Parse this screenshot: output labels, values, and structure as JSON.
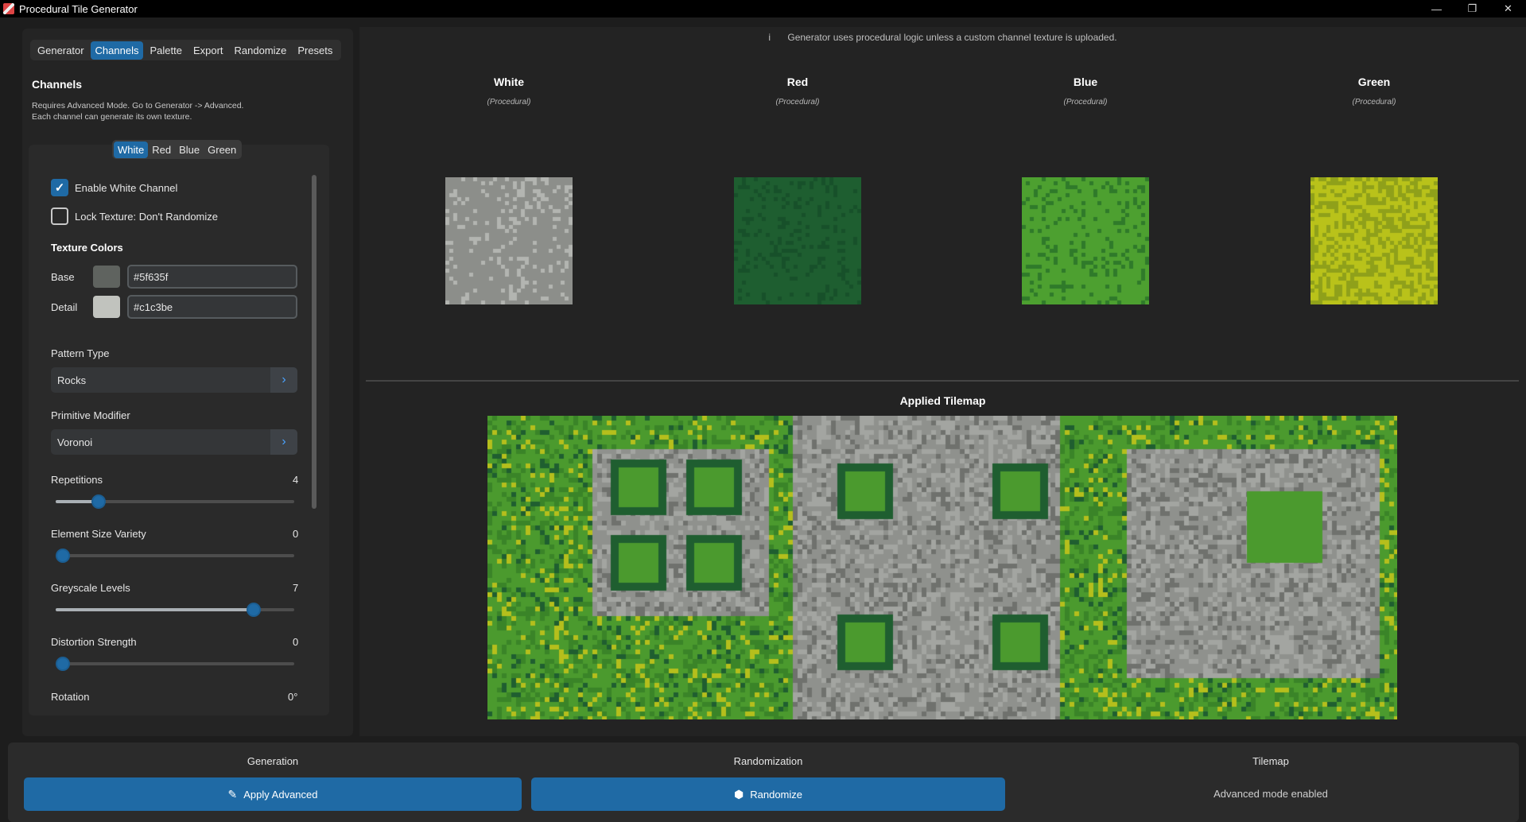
{
  "window": {
    "title": "Procedural Tile Generator",
    "buttons": [
      "—",
      "❐",
      "✕"
    ]
  },
  "left": {
    "tabs": [
      "Generator",
      "Channels",
      "Palette",
      "Export",
      "Randomize",
      "Presets"
    ],
    "active_tab": "Channels",
    "section_title": "Channels",
    "section_desc": "Requires Advanced Mode. Go to Generator -> Advanced. Each channel can generate its own texture.",
    "channel_tabs": [
      "White",
      "Red",
      "Blue",
      "Green"
    ],
    "active_channel": "White",
    "enable_label": "Enable White Channel",
    "enable_checked": true,
    "lock_label": "Lock Texture: Don't Randomize",
    "lock_checked": false,
    "texture_colors_title": "Texture Colors",
    "base_label": "Base",
    "base_color": "#5f635f",
    "detail_label": "Detail",
    "detail_color": "#c1c3be",
    "pattern_type_label": "Pattern Type",
    "pattern_type_value": "Rocks",
    "primitive_label": "Primitive Modifier",
    "primitive_value": "Voronoi",
    "sliders": [
      {
        "label": "Repetitions",
        "value": "4",
        "fraction": 0.18
      },
      {
        "label": "Element Size Variety",
        "value": "0",
        "fraction": 0.0
      },
      {
        "label": "Greyscale Levels",
        "value": "7",
        "fraction": 0.83
      },
      {
        "label": "Distortion Strength",
        "value": "0",
        "fraction": 0.0
      }
    ],
    "rotation_label": "Rotation",
    "rotation_value": "0°"
  },
  "right": {
    "info_icon": "i",
    "info_text": "Generator uses procedural logic unless a custom channel texture is uploaded.",
    "channels": [
      {
        "name": "White",
        "sub": "(Procedural)",
        "base": "#8c8e8a",
        "detail": "#b3b5b1"
      },
      {
        "name": "Red",
        "sub": "(Procedural)",
        "base": "#1e5e30",
        "detail": "#17502a"
      },
      {
        "name": "Blue",
        "sub": "(Procedural)",
        "base": "#4da030",
        "detail": "#2f7a2a"
      },
      {
        "name": "Green",
        "sub": "(Procedural)",
        "base": "#b9c21a",
        "detail": "#8fa01a"
      }
    ],
    "applied_title": "Applied Tilemap"
  },
  "bottom": {
    "generation_title": "Generation",
    "apply_label": "Apply Advanced",
    "randomization_title": "Randomization",
    "randomize_label": "Randomize",
    "tilemap_title": "Tilemap",
    "tilemap_status": "Advanced mode enabled"
  }
}
